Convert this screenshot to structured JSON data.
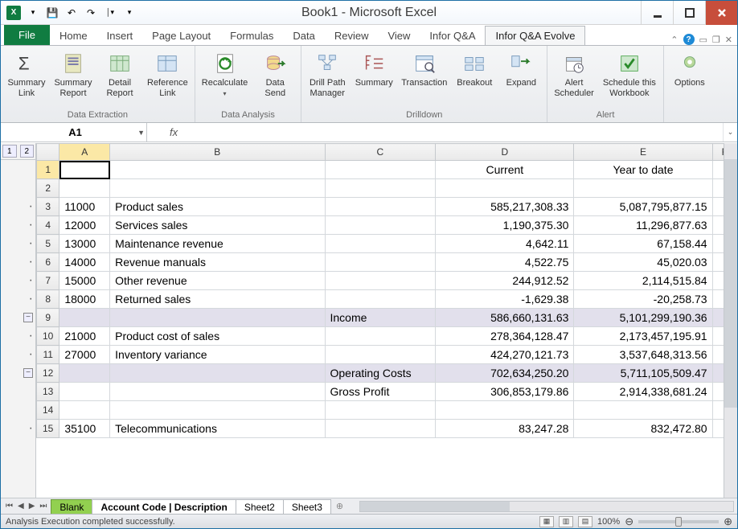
{
  "window": {
    "title": "Book1 - Microsoft Excel"
  },
  "qat": {
    "save": "💾",
    "undo": "↶",
    "redo": "↷",
    "more": "▾"
  },
  "tabs": {
    "file": "File",
    "home": "Home",
    "insert": "Insert",
    "page_layout": "Page Layout",
    "formulas": "Formulas",
    "data": "Data",
    "review": "Review",
    "view": "View",
    "infor_qa": "Infor Q&A",
    "infor_qa_evolve": "Infor Q&A Evolve"
  },
  "ribbon": {
    "groups": {
      "data_extraction": {
        "label": "Data Extraction",
        "buttons": {
          "summary_link": "Summary\nLink",
          "summary_report": "Summary\nReport",
          "detail_report": "Detail\nReport",
          "reference_link": "Reference\nLink"
        }
      },
      "data_analysis": {
        "label": "Data Analysis",
        "buttons": {
          "recalculate": "Recalculate",
          "data_send": "Data\nSend"
        }
      },
      "drilldown": {
        "label": "Drilldown",
        "buttons": {
          "drill_path_manager": "Drill Path\nManager",
          "summary": "Summary",
          "transaction": "Transaction",
          "breakout": "Breakout",
          "expand": "Expand"
        }
      },
      "alert": {
        "label": "Alert",
        "buttons": {
          "alert_scheduler": "Alert\nScheduler",
          "schedule_workbook": "Schedule this\nWorkbook"
        }
      },
      "options": {
        "label": "",
        "buttons": {
          "options": "Options"
        }
      }
    }
  },
  "name_box": {
    "value": "A1"
  },
  "formula_bar": {
    "fx_label": "fx",
    "value": ""
  },
  "columns": [
    "A",
    "B",
    "C",
    "D",
    "E",
    "F"
  ],
  "headers": {
    "d": "Current",
    "e": "Year to date"
  },
  "rows": [
    {
      "n": 1,
      "a": "",
      "b": "",
      "c": "",
      "d": "",
      "e": "",
      "active": true
    },
    {
      "n": 2
    },
    {
      "n": 3,
      "a": "11000",
      "b": "Product sales",
      "d": "585,217,308.33",
      "e": "5,087,795,877.15",
      "dot": true
    },
    {
      "n": 4,
      "a": "12000",
      "b": "Services sales",
      "d": "1,190,375.30",
      "e": "11,296,877.63",
      "dot": true
    },
    {
      "n": 5,
      "a": "13000",
      "b": "Maintenance revenue",
      "d": "4,642.11",
      "e": "67,158.44",
      "dot": true
    },
    {
      "n": 6,
      "a": "14000",
      "b": "Revenue manuals",
      "d": "4,522.75",
      "e": "45,020.03",
      "dot": true
    },
    {
      "n": 7,
      "a": "15000",
      "b": "Other revenue",
      "d": "244,912.52",
      "e": "2,114,515.84",
      "dot": true
    },
    {
      "n": 8,
      "a": "18000",
      "b": "Returned sales",
      "d": "-1,629.38",
      "e": "-20,258.73",
      "dot": true
    },
    {
      "n": 9,
      "c": "Income",
      "d": "586,660,131.63",
      "e": "5,101,299,190.36",
      "subtotal": true,
      "collapse": true
    },
    {
      "n": 10,
      "a": "21000",
      "b": "Product cost of sales",
      "d": "278,364,128.47",
      "e": "2,173,457,195.91",
      "dot": true
    },
    {
      "n": 11,
      "a": "27000",
      "b": "Inventory variance",
      "d": "424,270,121.73",
      "e": "3,537,648,313.56",
      "dot": true
    },
    {
      "n": 12,
      "c": "Operating Costs",
      "d": "702,634,250.20",
      "e": "5,711,105,509.47",
      "subtotal": true,
      "collapse": true
    },
    {
      "n": 13,
      "c": "Gross Profit",
      "d": "306,853,179.86",
      "e": "2,914,338,681.24"
    },
    {
      "n": 14
    },
    {
      "n": 15,
      "a": "35100",
      "b": "Telecommunications",
      "d": "83,247.28",
      "e": "832,472.80",
      "dot": true
    }
  ],
  "sheet_tabs": {
    "blank": "Blank",
    "active": "Account Code | Description",
    "sheet2": "Sheet2",
    "sheet3": "Sheet3"
  },
  "status": {
    "message": "Analysis Execution completed successfully.",
    "zoom": "100%"
  }
}
